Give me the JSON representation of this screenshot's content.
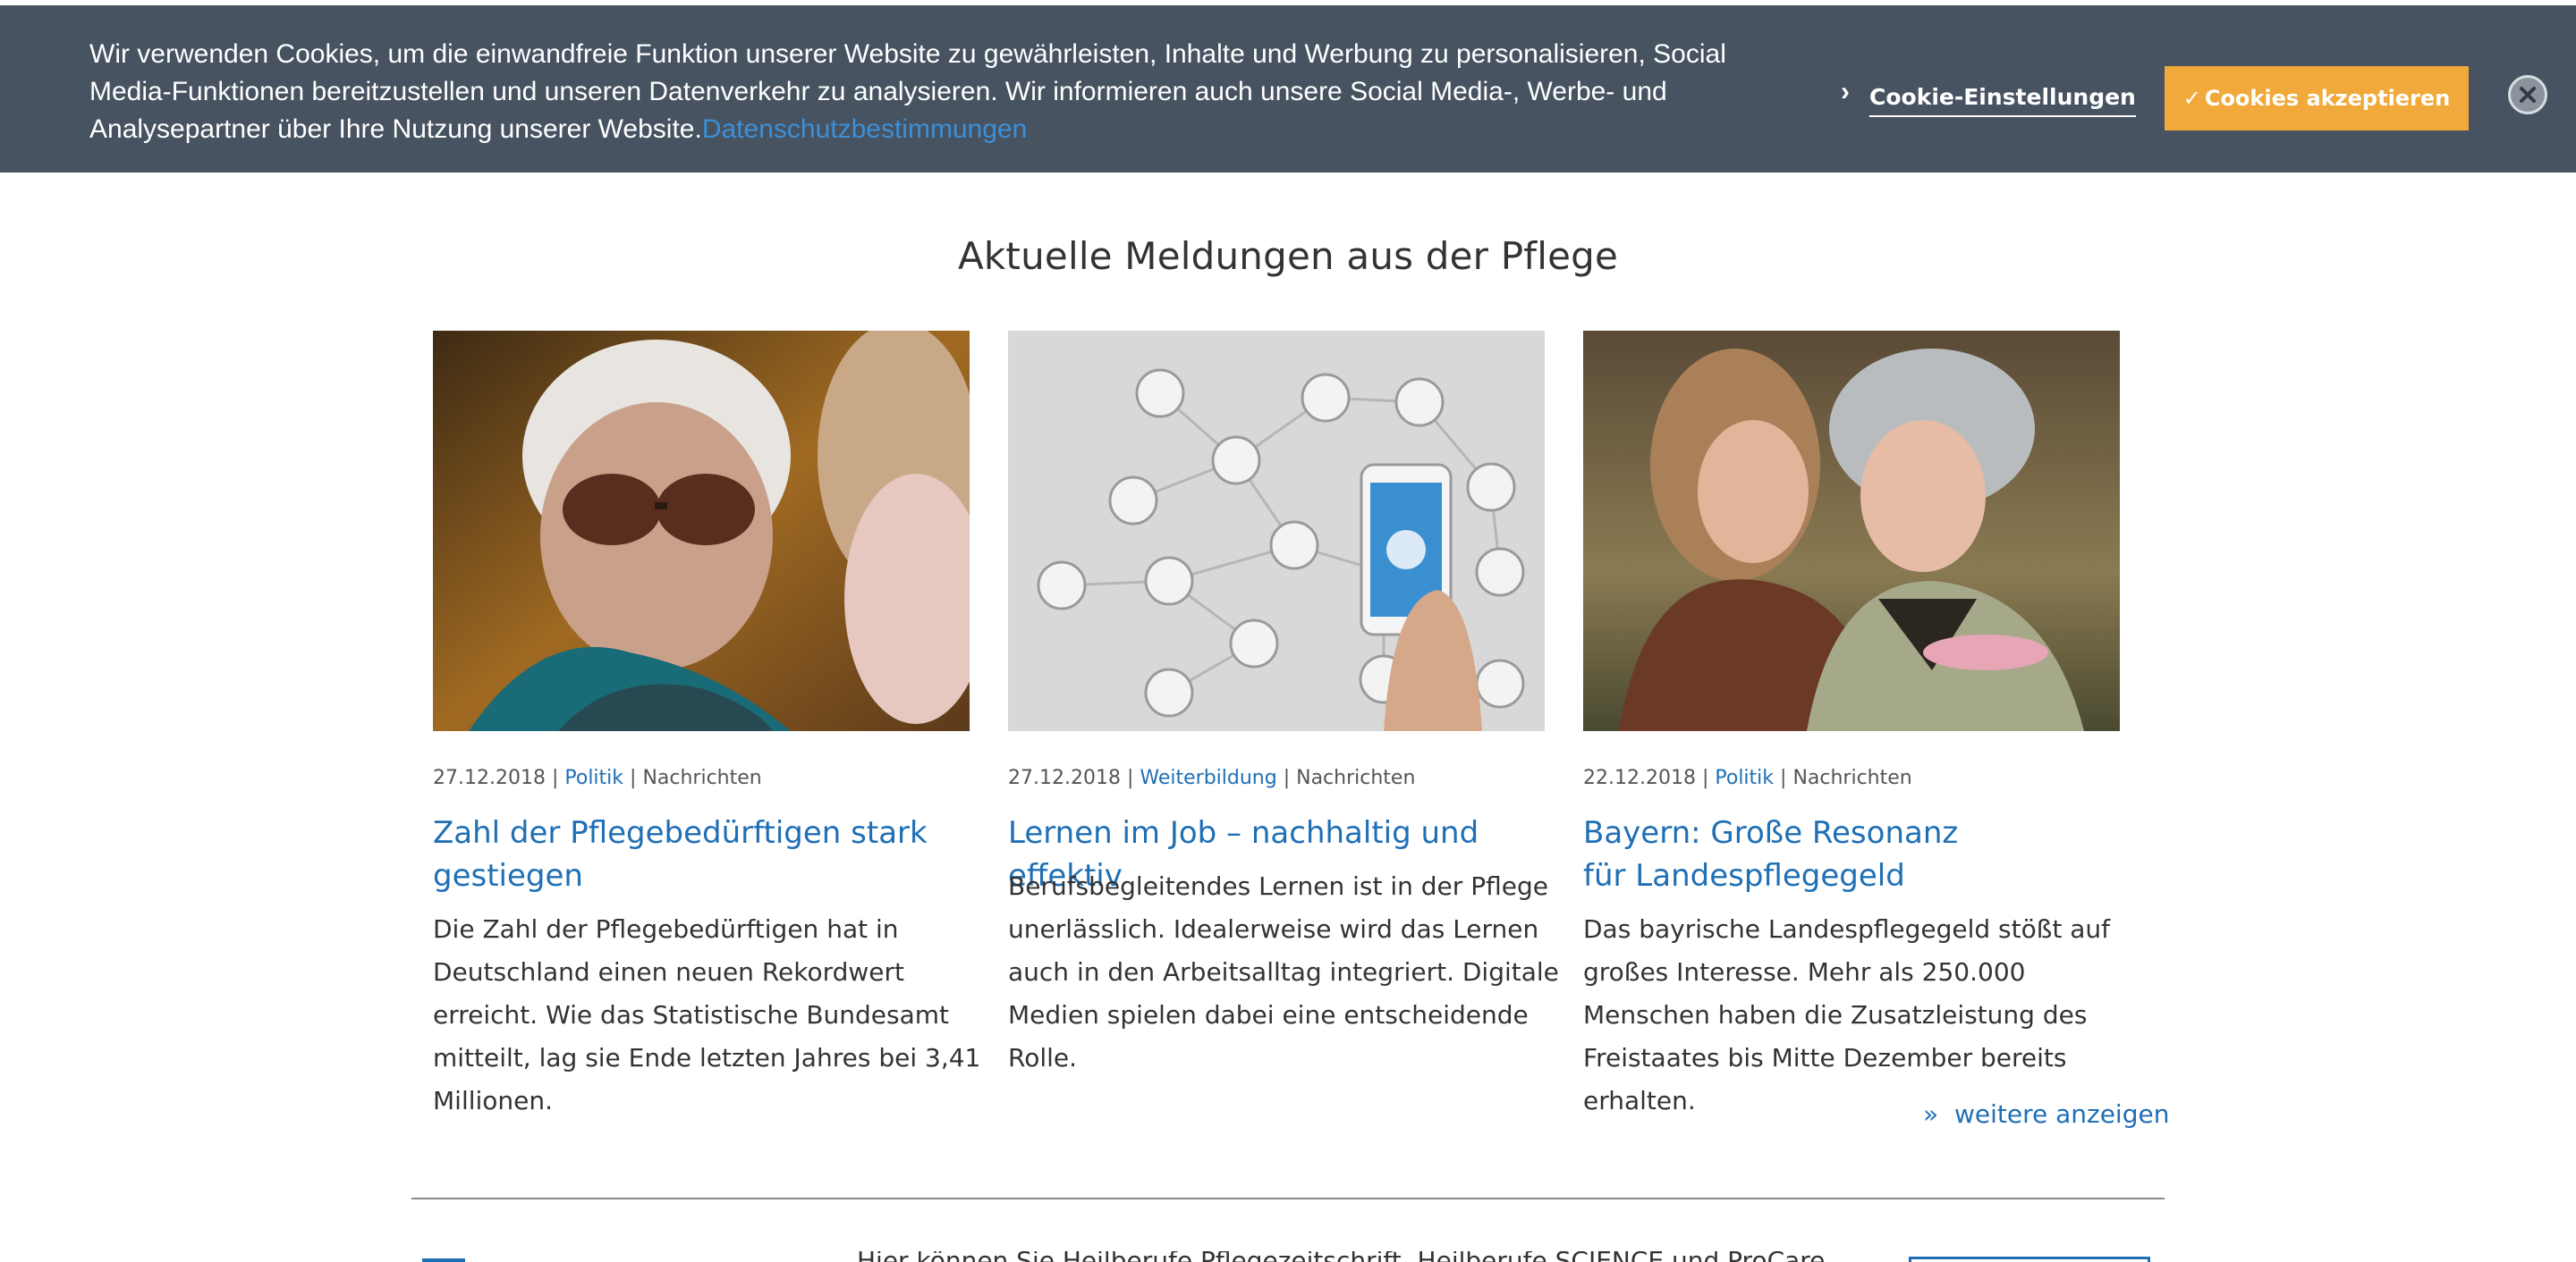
{
  "cookie_banner": {
    "text": "Wir verwenden Cookies, um die einwandfreie Funktion unserer Website zu gewährleisten, Inhalte und Werbung zu personalisieren, Social Media-Funktionen bereitzustellen und unseren Datenverkehr zu analysieren. Wir informieren auch unsere Social Media-, Werbe- und Analysepartner über Ihre Nutzung unserer Website.",
    "privacy_link": "Datenschutzbestimmungen",
    "settings_label": "Cookie-Einstellungen",
    "accept_label": "Cookies akzeptieren",
    "colors": {
      "background": "#475361",
      "accent": "#f0a93a",
      "link": "#3d8fd6"
    }
  },
  "section": {
    "title": "Aktuelle Meldungen aus der Pflege"
  },
  "articles": [
    {
      "date": "27.12.2018",
      "category": "Politik",
      "type": "Nachrichten",
      "title": "Zahl der Pflegebedürftigen stark gestiegen",
      "text": "Die Zahl der Pflegebedürftigen hat in Deutschland einen neuen Rekordwert erreicht. Wie das Statistische Bundesamt mitteilt, lag sie Ende letzten Jahres bei 3,41 Millionen."
    },
    {
      "date": "27.12.2018",
      "category": "Weiterbildung",
      "type": "Nachrichten",
      "title": "Lernen im Job – nachhaltig und effektiv",
      "text": "Berufsbegleitendes Lernen ist in der Pflege unerlässlich. Idealerweise wird das Lernen auch in den Arbeitsalltag integriert. Digitale Medien spielen dabei eine entscheidende Rolle."
    },
    {
      "date": "22.12.2018",
      "category": "Politik",
      "type": "Nachrichten",
      "title": "Bayern: Große Resonanz für Landespflegegeld",
      "text": "Das bayrische Landespflegegeld stößt auf großes Interesse. Mehr als 250.000 Menschen haben die Zusatzleistung des Freistaates bis Mitte Dezember bereits erhalten."
    }
  ],
  "more_link": {
    "prefix": "»",
    "label": "weitere anzeigen"
  },
  "footer": {
    "text": "Hier können Sie Heilberufe Pflegezeitschrift, Heilberufe SCIENCE und ProCare"
  },
  "colors": {
    "link": "#1f6fb5",
    "text": "#333333"
  }
}
